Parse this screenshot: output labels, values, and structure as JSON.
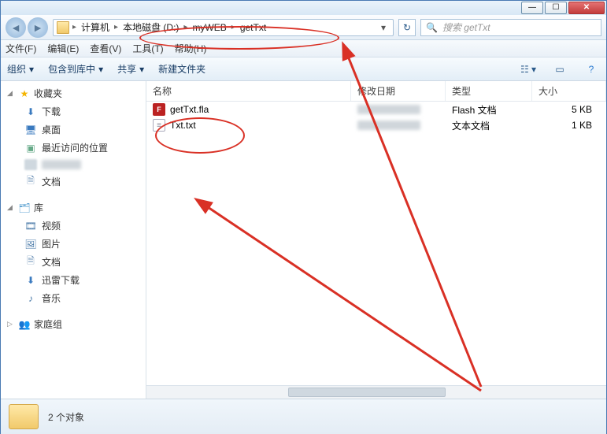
{
  "breadcrumb": {
    "segments": [
      "计算机",
      "本地磁盘 (D:)",
      "myWEB",
      "getTxt"
    ]
  },
  "search": {
    "placeholder": "搜索 getTxt"
  },
  "menu": {
    "file": "文件(F)",
    "edit": "编辑(E)",
    "view": "查看(V)",
    "tools": "工具(T)",
    "help": "帮助(H)"
  },
  "toolbar": {
    "organize": "组织",
    "include": "包含到库中",
    "share": "共享",
    "newfolder": "新建文件夹"
  },
  "sidebar": {
    "favorites": "收藏夹",
    "downloads": "下载",
    "desktop": "桌面",
    "recent": "最近访问的位置",
    "docs": "文档",
    "libraries": "库",
    "videos": "视频",
    "pictures": "图片",
    "docs2": "文档",
    "xunlei": "迅雷下载",
    "music": "音乐",
    "homegroup": "家庭组"
  },
  "columns": {
    "name": "名称",
    "date": "修改日期",
    "type": "类型",
    "size": "大小"
  },
  "files": [
    {
      "name": "getTxt.fla",
      "type": "Flash 文档",
      "size": "5 KB",
      "icon": "fla"
    },
    {
      "name": "Txt.txt",
      "type": "文本文档",
      "size": "1 KB",
      "icon": "txt"
    }
  ],
  "status": {
    "count": "2 个对象"
  }
}
